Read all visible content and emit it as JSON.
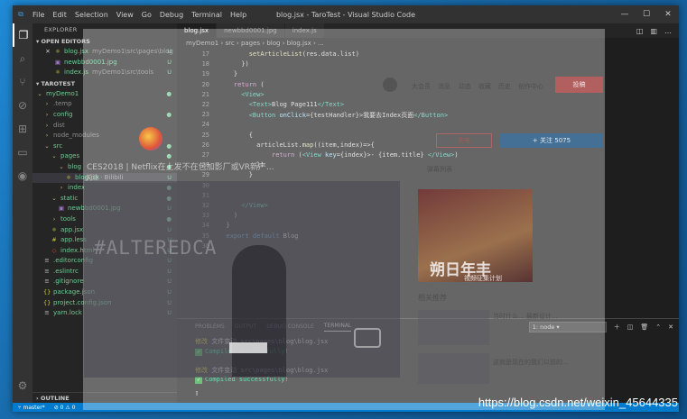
{
  "window": {
    "title": "blog.jsx - TaroTest - Visual Studio Code",
    "menu": [
      "File",
      "Edit",
      "Selection",
      "View",
      "Go",
      "Debug",
      "Terminal",
      "Help"
    ],
    "controls": {
      "minimize": "—",
      "maximize": "☐",
      "close": "✕"
    }
  },
  "activity_bar": {
    "items": [
      "explorer-icon",
      "search-icon",
      "source-control-icon",
      "debug-icon",
      "extensions-icon",
      "remote-icon",
      "spotify-icon"
    ],
    "bottom": "gear-icon"
  },
  "sidebar": {
    "header": "EXPLORER",
    "open_editors_label": "OPEN EDITORS",
    "open_editors": [
      {
        "name": "blog.jsx",
        "path": "myDemo1\\src\\pages\\blog",
        "status": "U",
        "modified": true
      },
      {
        "name": "newbbd0001.jpg",
        "path": "",
        "status": "U"
      },
      {
        "name": "index.js",
        "path": "myDemo1\\src\\tools",
        "status": "U"
      }
    ],
    "project_label": "TAROTEST",
    "tree": [
      {
        "name": "myDemo1",
        "kind": "folder-open",
        "depth": 0,
        "status": "●"
      },
      {
        "name": ".temp",
        "kind": "folder",
        "depth": 1,
        "status": ""
      },
      {
        "name": "config",
        "kind": "folder",
        "depth": 1,
        "status": "●"
      },
      {
        "name": "dist",
        "kind": "folder",
        "depth": 1,
        "status": ""
      },
      {
        "name": "node_modules",
        "kind": "folder",
        "depth": 1,
        "status": ""
      },
      {
        "name": "src",
        "kind": "folder-open",
        "depth": 1,
        "status": "●"
      },
      {
        "name": "pages",
        "kind": "folder-open",
        "depth": 2,
        "status": "●"
      },
      {
        "name": "blog",
        "kind": "folder-open",
        "depth": 3,
        "status": "●"
      },
      {
        "name": "blog.jsx",
        "kind": "file-js",
        "depth": 4,
        "status": "U"
      },
      {
        "name": "index",
        "kind": "folder",
        "depth": 3,
        "status": "●"
      },
      {
        "name": "static",
        "kind": "folder-open",
        "depth": 2,
        "status": "●"
      },
      {
        "name": "newbbd0001.jpg",
        "kind": "file-img",
        "depth": 3,
        "status": "U"
      },
      {
        "name": "tools",
        "kind": "folder",
        "depth": 2,
        "status": "●"
      },
      {
        "name": "app.jsx",
        "kind": "file-js",
        "depth": 2,
        "status": "U"
      },
      {
        "name": "app.less",
        "kind": "file-css",
        "depth": 2,
        "status": "U"
      },
      {
        "name": "index.html",
        "kind": "file-html",
        "depth": 2,
        "status": "U"
      },
      {
        "name": ".editorconfig",
        "kind": "file",
        "depth": 1,
        "status": "U"
      },
      {
        "name": ".eslintrc",
        "kind": "file",
        "depth": 1,
        "status": "U"
      },
      {
        "name": ".gitignore",
        "kind": "file",
        "depth": 1,
        "status": "U"
      },
      {
        "name": "package.json",
        "kind": "file-json",
        "depth": 1,
        "status": "U"
      },
      {
        "name": "project.config.json",
        "kind": "file-json",
        "depth": 1,
        "status": "U"
      },
      {
        "name": "yarn.lock",
        "kind": "file",
        "depth": 1,
        "status": "U"
      }
    ],
    "outline_label": "OUTLINE"
  },
  "editor": {
    "tabs": [
      {
        "label": "blog.jsx",
        "active": true
      },
      {
        "label": "newbbd0001.jpg",
        "active": false
      },
      {
        "label": "index.js",
        "active": false
      }
    ],
    "breadcrumb": [
      "myDemo1",
      "src",
      "pages",
      "blog",
      "blog.jsx",
      "..."
    ],
    "lines": [
      {
        "n": "17",
        "tokens": [
          [
            "fn",
            "        setArticleList"
          ],
          [
            "tx",
            "(res.data.list)"
          ]
        ]
      },
      {
        "n": "18",
        "tokens": [
          [
            "tx",
            "      })"
          ]
        ]
      },
      {
        "n": "19",
        "tokens": [
          [
            "tx",
            "    }"
          ]
        ]
      },
      {
        "n": "20",
        "tokens": [
          [
            "kw2",
            "    return"
          ],
          [
            "tx",
            " ("
          ]
        ]
      },
      {
        "n": "21",
        "tokens": [
          [
            "tg",
            "      <View>"
          ]
        ]
      },
      {
        "n": "22",
        "tokens": [
          [
            "tg",
            "        <Text>"
          ],
          [
            "tx",
            "Blog Page111"
          ],
          [
            "tg",
            "</Text>"
          ]
        ]
      },
      {
        "n": "23",
        "tokens": [
          [
            "tg",
            "        <Button "
          ],
          [
            "at",
            "onClick"
          ],
          [
            "tx",
            "={testHandler}>我要去Index页面"
          ],
          [
            "tg",
            "</Button>"
          ]
        ]
      },
      {
        "n": "24",
        "tokens": [
          [
            "tx",
            ""
          ]
        ]
      },
      {
        "n": "25",
        "tokens": [
          [
            "tx",
            "        {"
          ]
        ]
      },
      {
        "n": "26",
        "tokens": [
          [
            "tx",
            "          articleList."
          ],
          [
            "fn",
            "map"
          ],
          [
            "tx",
            "((item,index)=>{"
          ]
        ]
      },
      {
        "n": "27",
        "tokens": [
          [
            "kw2",
            "              return"
          ],
          [
            "tx",
            " ("
          ],
          [
            "tg",
            "<View "
          ],
          [
            "at",
            "key"
          ],
          [
            "tx",
            "={index}>- {item.title} "
          ],
          [
            "tg",
            "</View>"
          ],
          [
            "tx",
            ")"
          ]
        ]
      },
      {
        "n": "28",
        "tokens": [
          [
            "tx",
            "          })"
          ]
        ]
      },
      {
        "n": "29",
        "tokens": [
          [
            "tx",
            "        }"
          ]
        ]
      },
      {
        "n": "30",
        "tokens": [
          [
            "tx",
            ""
          ]
        ]
      },
      {
        "n": "31",
        "tokens": [
          [
            "tx",
            ""
          ]
        ]
      },
      {
        "n": "32",
        "tokens": [
          [
            "tg",
            "      </View>"
          ]
        ]
      },
      {
        "n": "33",
        "tokens": [
          [
            "tx",
            "    )"
          ]
        ]
      },
      {
        "n": "34",
        "tokens": [
          [
            "tx",
            "  }"
          ]
        ]
      },
      {
        "n": "35",
        "tokens": [
          [
            "kw",
            "  export default"
          ],
          [
            "tx",
            " Blog"
          ]
        ]
      },
      {
        "n": "36",
        "tokens": [
          [
            "tx",
            ""
          ]
        ]
      }
    ]
  },
  "panel": {
    "tabs": [
      "PROBLEMS",
      "OUTPUT",
      "DEBUG CONSOLE",
      "TERMINAL"
    ],
    "active_tab": "TERMINAL",
    "terminal_select": "1: node",
    "terminal_lines": [
      {
        "label": "修改",
        "event": "文件变动",
        "path": "src\\pages\\blog\\blog.jsx",
        "result": "Compiled successfully!"
      },
      {
        "label": "修改",
        "event": "文件变动",
        "path": "src\\pages\\blog\\blog.jsx",
        "result": "Compiled successfully!"
      }
    ],
    "prompt": "▯"
  },
  "status_bar": {
    "branch": "master*",
    "problems": "⊘ 0 ⚠ 0"
  },
  "ghost_overlay": {
    "left_texts": [
      "CES2018 | Netflix在上发不在包加影厂或VR新产...",
      "关注 · Bilibili"
    ],
    "top_nav": [
      "大会员",
      "消息",
      "动态",
      "收藏",
      "历史",
      "创作中心"
    ],
    "buttons": {
      "contribute": "投稿",
      "follow": "+ 关注 5075",
      "charge": "充电"
    },
    "right_panel": {
      "playlist_title": "弹幕列表",
      "related_title": "相关推荐",
      "related_items": [
        "当时什么... 最新设计...",
        "这就是现在的我们以前的..."
      ]
    },
    "poster": {
      "big": "朔日年丰",
      "small": "视频征集计划"
    },
    "video_banner": "#ALTEREDCA"
  },
  "watermark": "https://blog.csdn.net/weixin_45644335",
  "colors": {
    "accent": "#007acc",
    "editor_bg": "#1e1e1e",
    "sidebar_bg": "#252526",
    "untracked": "#73c991"
  }
}
